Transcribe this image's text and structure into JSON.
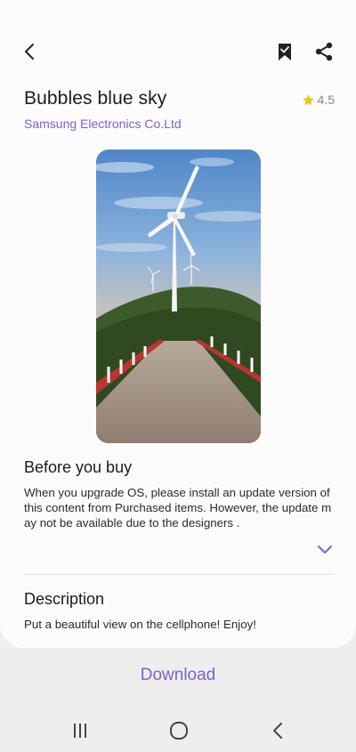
{
  "header": {
    "back_icon": "chevron-left-icon",
    "bookmark_icon": "bookmark-check-icon",
    "share_icon": "share-icon"
  },
  "theme": {
    "title": "Bubbles blue sky",
    "publisher": "Samsung Electronics Co.Ltd",
    "rating": "4.5",
    "rating_icon": "star-icon",
    "accent_color": "#7b62c9",
    "star_color": "#f4c20d"
  },
  "before_buy": {
    "heading": "Before you buy",
    "text": "When you upgrade OS, please install an update version of this content from Purchased items. However, the update may not be available due to the designers .",
    "expand_icon": "chevron-down-icon"
  },
  "description": {
    "heading": "Description",
    "text": "Put a beautiful view on the cellphone! Enjoy!"
  },
  "download_label": "Download",
  "navbar": {
    "recents_icon": "recents-icon",
    "home_icon": "home-icon",
    "back_icon": "back-icon"
  }
}
